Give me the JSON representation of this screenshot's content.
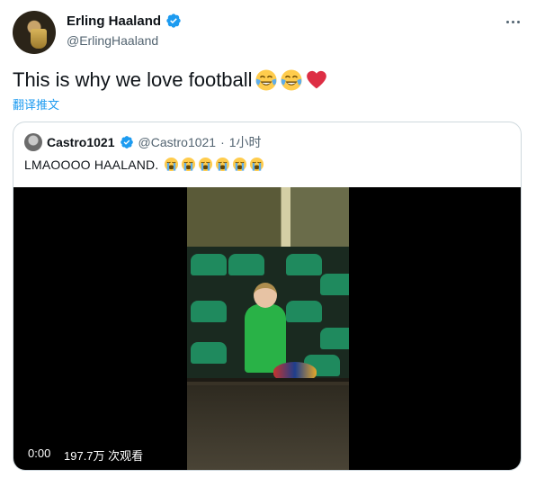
{
  "author": {
    "name": "Erling Haaland",
    "handle": "@ErlingHaaland",
    "verified": true,
    "avatar_icon": "avatar-photo"
  },
  "tweet": {
    "text": "This is why we love football",
    "emojis": [
      "face-with-tears-of-joy",
      "face-with-tears-of-joy",
      "red-heart"
    ],
    "translate_label": "翻译推文"
  },
  "quoted": {
    "name": "Castro1021",
    "handle": "@Castro1021",
    "separator": "·",
    "time": "1小时",
    "verified": true,
    "text": "LMAOOOO HAALAND.",
    "emojis": [
      "loudly-crying-face",
      "loudly-crying-face",
      "loudly-crying-face",
      "loudly-crying-face",
      "loudly-crying-face",
      "loudly-crying-face"
    ]
  },
  "video": {
    "time": "0:00",
    "views": "197.7万 次观看"
  },
  "colors": {
    "accent": "#1d9bf0",
    "text": "#0f1419",
    "secondary": "#536471",
    "border": "#cfd9de"
  },
  "icons": {
    "more": "more-dots-icon",
    "verified": "verified-badge-icon"
  }
}
